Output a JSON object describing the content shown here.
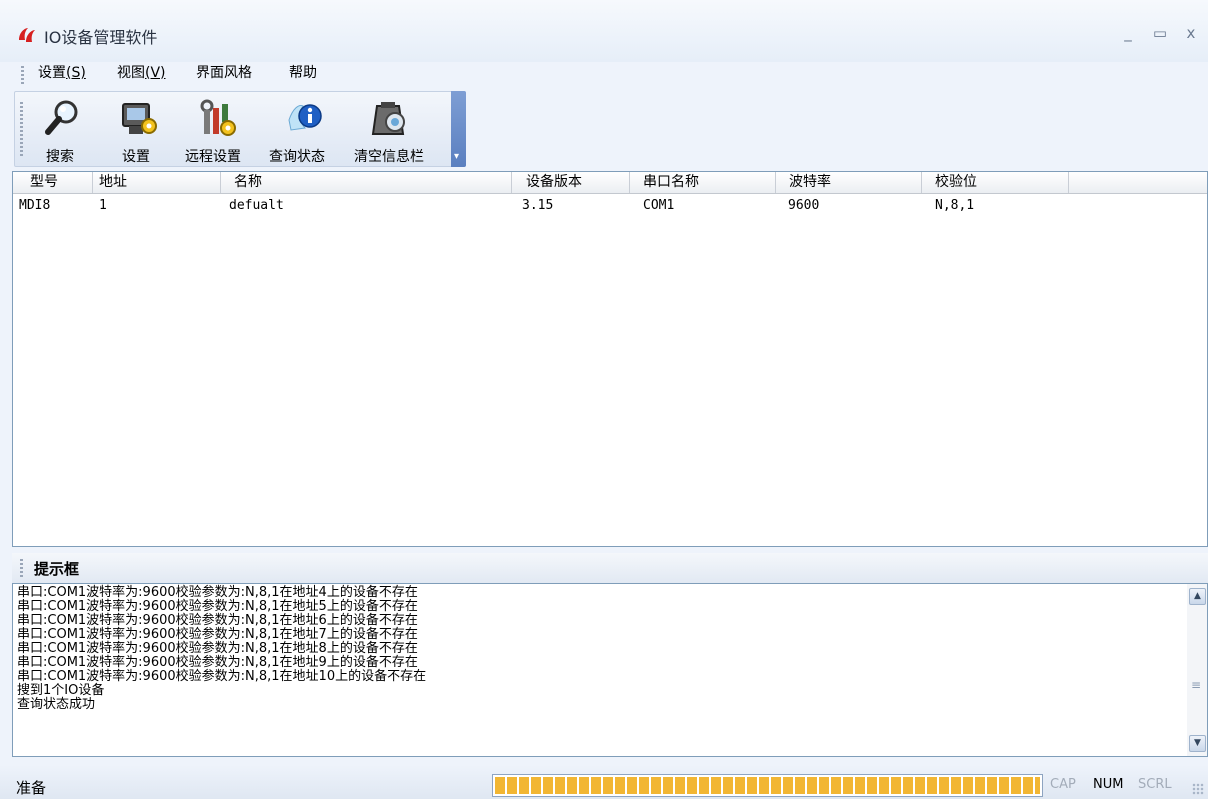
{
  "window": {
    "title": "IO设备管理软件",
    "minimize": "_",
    "maximize": "▭",
    "close": "x"
  },
  "menu": [
    {
      "label": "设置",
      "shortcut": "(S)"
    },
    {
      "label": "视图",
      "shortcut": "(V)"
    },
    {
      "label": "界面风格",
      "shortcut": ""
    },
    {
      "label": "帮助",
      "shortcut": ""
    }
  ],
  "toolbar": {
    "search": "搜索",
    "settings": "设置",
    "remote_settings": "远程设置",
    "query_status": "查询状态",
    "clear_info": "清空信息栏",
    "overflow": "▾"
  },
  "table": {
    "columns": [
      "型号",
      "地址",
      "名称",
      "设备版本",
      "串口名称",
      "波特率",
      "校验位"
    ],
    "rows": [
      {
        "model": "MDI8",
        "address": "1",
        "name": "defualt",
        "version": "3.15",
        "port": "COM1",
        "baud": "9600",
        "parity": "N,8,1"
      }
    ]
  },
  "hint": {
    "title": "提示框",
    "lines": [
      "串口:COM1波特率为:9600校验参数为:N,8,1在地址4上的设备不存在",
      "串口:COM1波特率为:9600校验参数为:N,8,1在地址5上的设备不存在",
      "串口:COM1波特率为:9600校验参数为:N,8,1在地址6上的设备不存在",
      "串口:COM1波特率为:9600校验参数为:N,8,1在地址7上的设备不存在",
      "串口:COM1波特率为:9600校验参数为:N,8,1在地址8上的设备不存在",
      "串口:COM1波特率为:9600校验参数为:N,8,1在地址9上的设备不存在",
      "串口:COM1波特率为:9600校验参数为:N,8,1在地址10上的设备不存在",
      "搜到1个IO设备",
      "查询状态成功"
    ]
  },
  "status": {
    "text": "准备",
    "progress": 1.0,
    "cap": "CAP",
    "num": "NUM",
    "scrl": "SCRL"
  },
  "colors": {
    "progress": "#f2b633",
    "accent": "#5a7fc0",
    "logo": "#d61f1f"
  }
}
